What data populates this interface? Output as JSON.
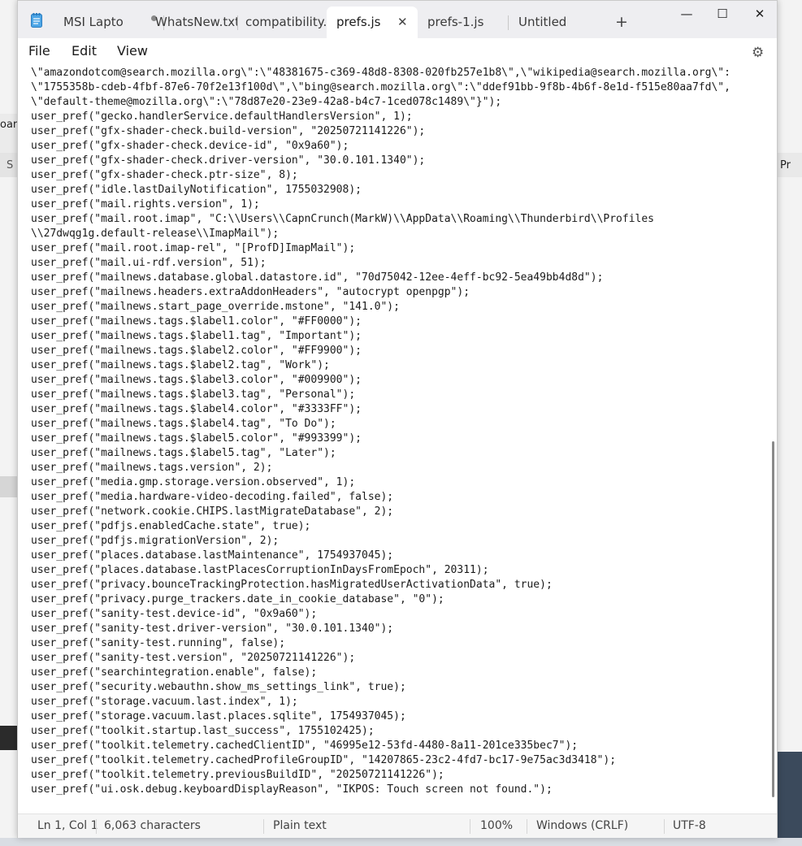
{
  "tabs": [
    {
      "label": "MSI Lapto",
      "modified": true
    },
    {
      "label": "WhatsNew.txt"
    },
    {
      "label": "compatibility.ir"
    },
    {
      "label": "prefs.js",
      "active": true
    },
    {
      "label": "prefs-1.js"
    },
    {
      "label": "Untitled"
    }
  ],
  "menu": {
    "file": "File",
    "edit": "Edit",
    "view": "View"
  },
  "icons": {
    "new_tab": "+",
    "close_tab": "✕",
    "minimize": "—",
    "maximize": "☐",
    "close_window": "✕",
    "settings": "⚙"
  },
  "editor": {
    "lines": [
      "\\\"amazondotcom@search.mozilla.org\\\":\\\"48381675-c369-48d8-8308-020fb257e1b8\\\",\\\"wikipedia@search.mozilla.org\\\":",
      "\\\"1755358b-cdeb-4fbf-87e6-70f2e13f100d\\\",\\\"bing@search.mozilla.org\\\":\\\"ddef91bb-9f8b-4b6f-8e1d-f515e80aa7fd\\\",",
      "\\\"default-theme@mozilla.org\\\":\\\"78d87e20-23e9-42a8-b4c7-1ced078c1489\\\"}\");",
      "user_pref(\"gecko.handlerService.defaultHandlersVersion\", 1);",
      "user_pref(\"gfx-shader-check.build-version\", \"20250721141226\");",
      "user_pref(\"gfx-shader-check.device-id\", \"0x9a60\");",
      "user_pref(\"gfx-shader-check.driver-version\", \"30.0.101.1340\");",
      "user_pref(\"gfx-shader-check.ptr-size\", 8);",
      "user_pref(\"idle.lastDailyNotification\", 1755032908);",
      "user_pref(\"mail.rights.version\", 1);",
      "user_pref(\"mail.root.imap\", \"C:\\\\Users\\\\CapnCrunch(MarkW)\\\\AppData\\\\Roaming\\\\Thunderbird\\\\Profiles",
      "\\\\27dwqg1g.default-release\\\\ImapMail\");",
      "user_pref(\"mail.root.imap-rel\", \"[ProfD]ImapMail\");",
      "user_pref(\"mail.ui-rdf.version\", 51);",
      "user_pref(\"mailnews.database.global.datastore.id\", \"70d75042-12ee-4eff-bc92-5ea49bb4d8d\");",
      "user_pref(\"mailnews.headers.extraAddonHeaders\", \"autocrypt openpgp\");",
      "user_pref(\"mailnews.start_page_override.mstone\", \"141.0\");",
      "user_pref(\"mailnews.tags.$label1.color\", \"#FF0000\");",
      "user_pref(\"mailnews.tags.$label1.tag\", \"Important\");",
      "user_pref(\"mailnews.tags.$label2.color\", \"#FF9900\");",
      "user_pref(\"mailnews.tags.$label2.tag\", \"Work\");",
      "user_pref(\"mailnews.tags.$label3.color\", \"#009900\");",
      "user_pref(\"mailnews.tags.$label3.tag\", \"Personal\");",
      "user_pref(\"mailnews.tags.$label4.color\", \"#3333FF\");",
      "user_pref(\"mailnews.tags.$label4.tag\", \"To Do\");",
      "user_pref(\"mailnews.tags.$label5.color\", \"#993399\");",
      "user_pref(\"mailnews.tags.$label5.tag\", \"Later\");",
      "user_pref(\"mailnews.tags.version\", 2);",
      "user_pref(\"media.gmp.storage.version.observed\", 1);",
      "user_pref(\"media.hardware-video-decoding.failed\", false);",
      "user_pref(\"network.cookie.CHIPS.lastMigrateDatabase\", 2);",
      "user_pref(\"pdfjs.enabledCache.state\", true);",
      "user_pref(\"pdfjs.migrationVersion\", 2);",
      "user_pref(\"places.database.lastMaintenance\", 1754937045);",
      "user_pref(\"places.database.lastPlacesCorruptionInDaysFromEpoch\", 20311);",
      "user_pref(\"privacy.bounceTrackingProtection.hasMigratedUserActivationData\", true);",
      "user_pref(\"privacy.purge_trackers.date_in_cookie_database\", \"0\");",
      "user_pref(\"sanity-test.device-id\", \"0x9a60\");",
      "user_pref(\"sanity-test.driver-version\", \"30.0.101.1340\");",
      "user_pref(\"sanity-test.running\", false);",
      "user_pref(\"sanity-test.version\", \"20250721141226\");",
      "user_pref(\"searchintegration.enable\", false);",
      "user_pref(\"security.webauthn.show_ms_settings_link\", true);",
      "user_pref(\"storage.vacuum.last.index\", 1);",
      "user_pref(\"storage.vacuum.last.places.sqlite\", 1754937045);",
      "user_pref(\"toolkit.startup.last_success\", 1755102425);",
      "user_pref(\"toolkit.telemetry.cachedClientID\", \"46995e12-53fd-4480-8a11-201ce335bec7\");",
      "user_pref(\"toolkit.telemetry.cachedProfileGroupID\", \"14207865-23c2-4fd7-bc17-9e75ac3d3418\");",
      "user_pref(\"toolkit.telemetry.previousBuildID\", \"20250721141226\");",
      "user_pref(\"ui.osk.debug.keyboardDisplayReason\", \"IKPOS: Touch screen not found.\");"
    ]
  },
  "status": {
    "position": "Ln 1, Col 1",
    "characters": "6,063 characters",
    "format": "Plain text",
    "zoom": "100%",
    "line_ending": "Windows (CRLF)",
    "encoding": "UTF-8"
  },
  "background": {
    "left_fragments": [
      "oar",
      "S"
    ],
    "right_fragment": "Pr"
  }
}
